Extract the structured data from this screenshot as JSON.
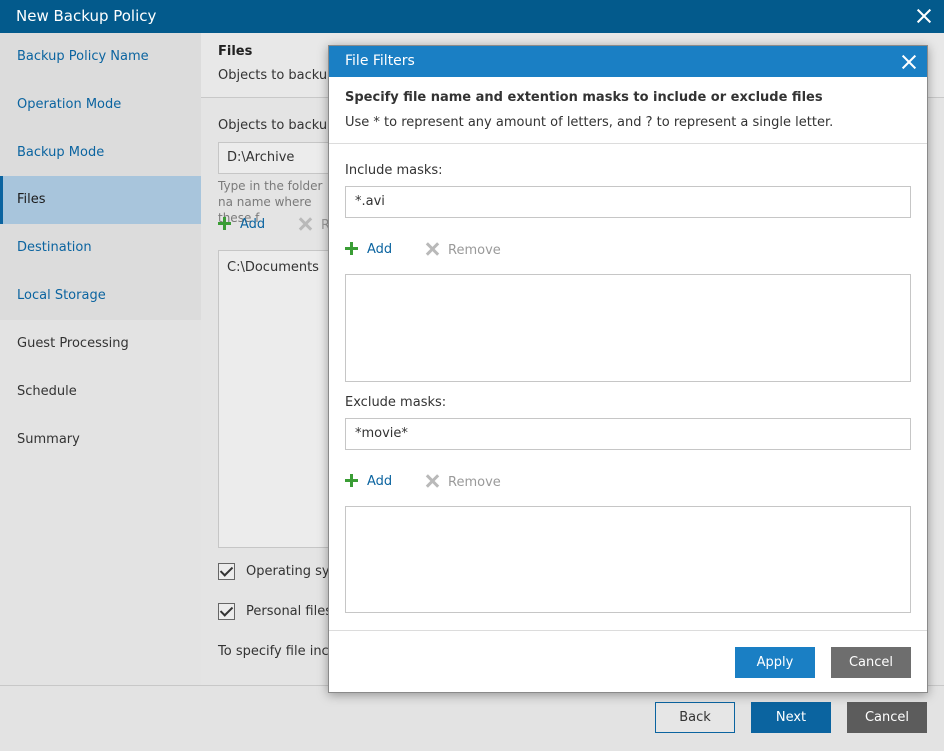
{
  "window": {
    "title": "New Backup Policy"
  },
  "sidebar": {
    "items": [
      {
        "label": "Backup Policy Name"
      },
      {
        "label": "Operation Mode"
      },
      {
        "label": "Backup Mode"
      },
      {
        "label": "Files"
      },
      {
        "label": "Destination"
      },
      {
        "label": "Local Storage"
      },
      {
        "label": "Guest Processing"
      },
      {
        "label": "Schedule"
      },
      {
        "label": "Summary"
      }
    ]
  },
  "page": {
    "title": "Files",
    "description": "Objects to backup.",
    "objects_label": "Objects to backup:",
    "folder_value": "D:\\Archive",
    "hint": "Type in the folder na name where these f",
    "add_label": "Add",
    "remove_label": "R",
    "list_items": [
      "C:\\Documents"
    ],
    "os_checkbox_label": "Operating sys",
    "personal_checkbox_label": "Personal files",
    "bottom_text": "To specify file inclu"
  },
  "footer": {
    "back_label": "Back",
    "next_label": "Next",
    "cancel_label": "Cancel"
  },
  "modal": {
    "title": "File Filters",
    "heading": "Specify file name and extention masks to include or exclude files",
    "subheading": "Use * to represent any amount of letters, and ? to represent a single letter.",
    "include": {
      "label": "Include masks:",
      "value": "*.avi",
      "add_label": "Add",
      "remove_label": "Remove"
    },
    "exclude": {
      "label": "Exclude masks:",
      "value": "*movie*",
      "add_label": "Add",
      "remove_label": "Remove"
    },
    "apply_label": "Apply",
    "cancel_label": "Cancel"
  },
  "colors": {
    "title_bar": "#035a8c",
    "modal_title_bar": "#1a7fc4",
    "add_icon": "#3a9d35",
    "link": "#0b64a0"
  }
}
